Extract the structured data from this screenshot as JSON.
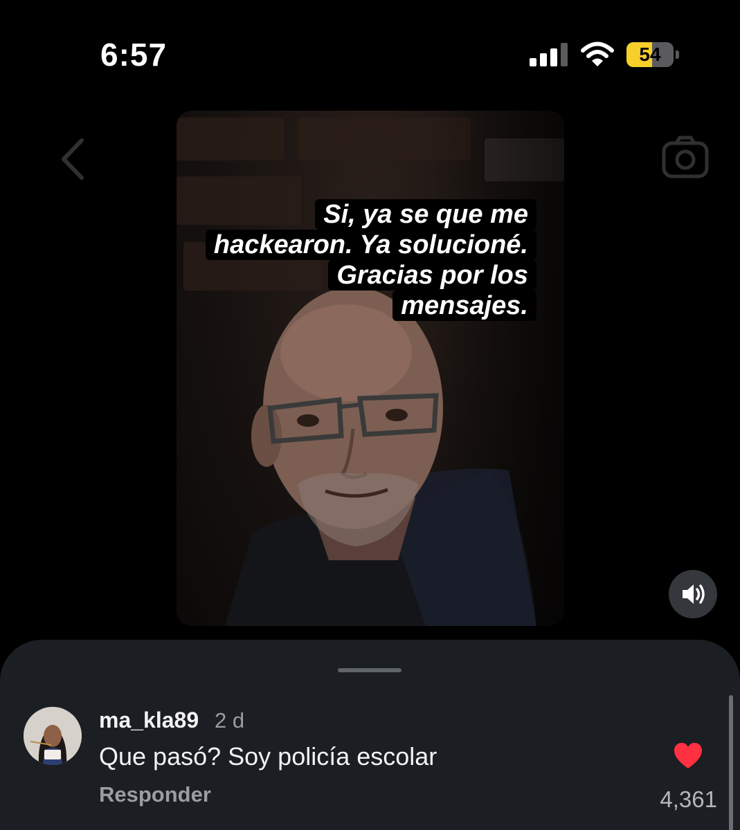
{
  "status_bar": {
    "time": "6:57",
    "battery_level": "54",
    "battery_fraction": 0.54,
    "battery_color": "#f7cf2a",
    "icons": [
      "signal-icon",
      "wifi-icon",
      "battery-icon"
    ]
  },
  "story": {
    "caption_lines": [
      "Si, ya se que me",
      "hackearon. Ya solucioné.",
      "Gracias por los",
      "mensajes."
    ],
    "icons": [
      "back-icon",
      "camera-icon",
      "volume-icon"
    ]
  },
  "comments": {
    "items": [
      {
        "username": "ma_kla89",
        "time": "2 d",
        "text": "Que pasó? Soy policía escolar",
        "reply_label": "Responder",
        "likes": "4,361",
        "liked": true,
        "heart_color": "#ff3040"
      }
    ]
  }
}
